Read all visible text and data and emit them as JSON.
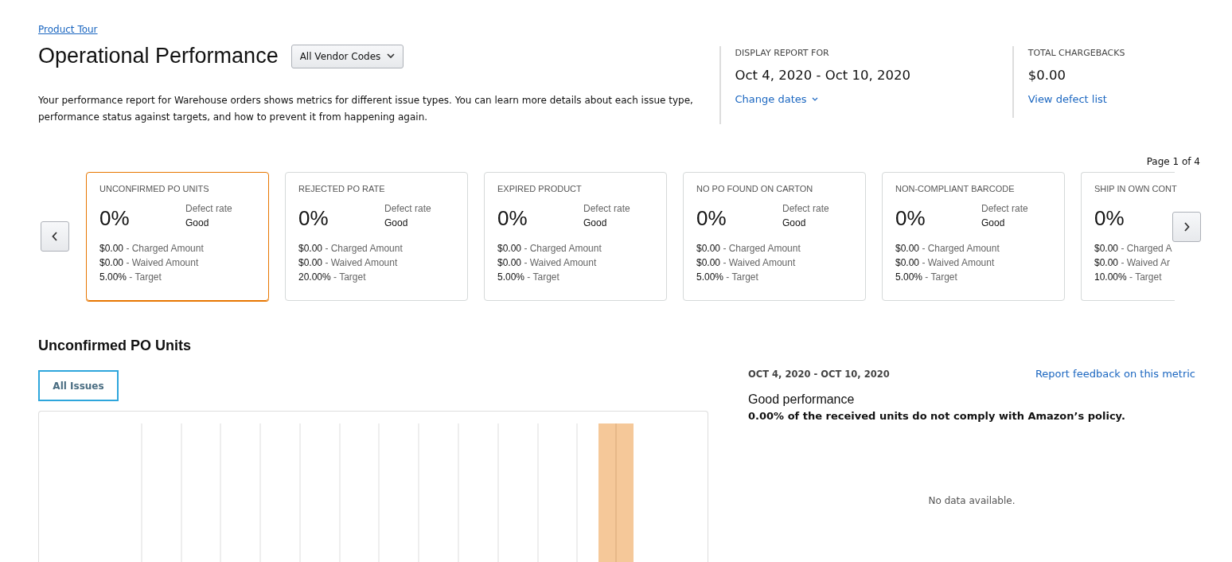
{
  "header": {
    "tour_link": "Product Tour",
    "title": "Operational Performance",
    "vendor_dropdown": "All Vendor Codes",
    "description": "Your performance report for Warehouse orders shows metrics for different issue types. You can learn more details about each issue type, performance status against targets, and how to prevent it from happening again."
  },
  "report": {
    "label": "DISPLAY REPORT FOR",
    "range": "Oct 4, 2020 - Oct 10, 2020",
    "change_link": "Change dates"
  },
  "chargebacks": {
    "label": "TOTAL CHARGEBACKS",
    "value": "$0.00",
    "link": "View defect list"
  },
  "pager": "Page 1 of 4",
  "cards": [
    {
      "kind": "full",
      "selected": true,
      "title": "UNCONFIRMED PO UNITS",
      "rate": "0%",
      "rate_label": "Defect rate",
      "status": "Good",
      "charged": "$0.00",
      "charged_label": "- Charged Amount",
      "waived": "$0.00",
      "waived_label": "- Waived Amount",
      "target": "5.00%",
      "target_label": "- Target"
    },
    {
      "kind": "full",
      "selected": false,
      "title": "REJECTED PO RATE",
      "rate": "0%",
      "rate_label": "Defect rate",
      "status": "Good",
      "charged": "$0.00",
      "charged_label": "- Charged Amount",
      "waived": "$0.00",
      "waived_label": "- Waived Amount",
      "target": "20.00%",
      "target_label": "- Target"
    },
    {
      "kind": "full",
      "selected": false,
      "title": "EXPIRED PRODUCT",
      "rate": "0%",
      "rate_label": "Defect rate",
      "status": "Good",
      "charged": "$0.00",
      "charged_label": "- Charged Amount",
      "waived": "$0.00",
      "waived_label": "- Waived Amount",
      "target": "5.00%",
      "target_label": "- Target"
    },
    {
      "kind": "full",
      "selected": false,
      "title": "NO PO FOUND ON CARTON",
      "rate": "0%",
      "rate_label": "Defect rate",
      "status": "Good",
      "charged": "$0.00",
      "charged_label": "- Charged Amount",
      "waived": "$0.00",
      "waived_label": "- Waived Amount",
      "target": "5.00%",
      "target_label": "- Target"
    },
    {
      "kind": "full",
      "selected": false,
      "title": "NON-COMPLIANT BARCODE",
      "rate": "0%",
      "rate_label": "Defect rate",
      "status": "Good",
      "charged": "$0.00",
      "charged_label": "- Charged Amount",
      "waived": "$0.00",
      "waived_label": "- Waived Amount",
      "target": "5.00%",
      "target_label": "- Target"
    },
    {
      "kind": "partial",
      "selected": false,
      "title": "SHIP IN OWN CONT",
      "rate": "0%",
      "charged": "$0.00",
      "charged_label": "- Charged A",
      "waived": "$0.00",
      "waived_label": "- Waived Ar",
      "target": "10.00%",
      "target_label": "- Target"
    }
  ],
  "detail": {
    "title": "Unconfirmed PO Units",
    "filter_button": "All Issues",
    "range": "OCT 4, 2020 - OCT 10, 2020",
    "feedback_link": "Report feedback on this metric",
    "performance": "Good performance",
    "policy": "0.00% of the received units do not comply with Amazon’s policy.",
    "empty": "No data available."
  }
}
